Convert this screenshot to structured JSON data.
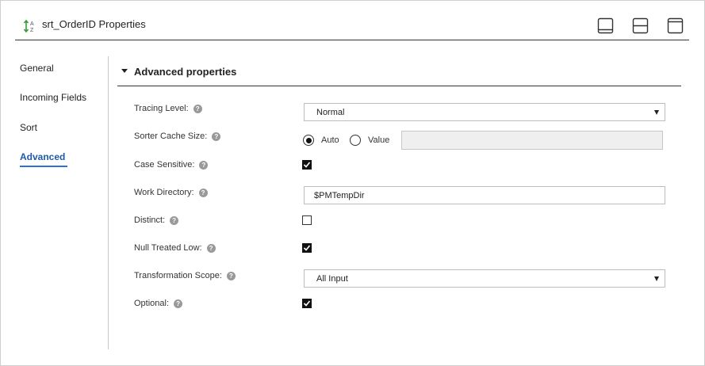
{
  "header": {
    "title": "srt_OrderID Properties",
    "icon": "sort-az-icon",
    "window_buttons": [
      "dock-bottom-icon",
      "split-horizontal-icon",
      "maximize-icon"
    ]
  },
  "nav": {
    "items": [
      {
        "label": "General",
        "active": false
      },
      {
        "label": "Incoming Fields",
        "active": false
      },
      {
        "label": "Sort",
        "active": false
      },
      {
        "label": "Advanced",
        "active": true
      }
    ]
  },
  "section": {
    "title": "Advanced properties",
    "expanded": true
  },
  "fields": {
    "tracing_level": {
      "label": "Tracing Level:",
      "value": "Normal"
    },
    "sorter_cache_size": {
      "label": "Sorter Cache Size:",
      "option_auto": "Auto",
      "option_value": "Value",
      "selected": "Auto",
      "value": ""
    },
    "case_sensitive": {
      "label": "Case Sensitive:",
      "checked": true
    },
    "work_directory": {
      "label": "Work Directory:",
      "value": "$PMTempDir"
    },
    "distinct": {
      "label": "Distinct:",
      "checked": false
    },
    "null_treated_low": {
      "label": "Null Treated Low:",
      "checked": true
    },
    "transformation_scope": {
      "label": "Transformation Scope:",
      "value": "All Input"
    },
    "optional": {
      "label": "Optional:",
      "checked": true
    }
  },
  "colors": {
    "accent": "#2a6fdb",
    "active_nav_text": "#1e5aa8",
    "help_icon": "#999999"
  }
}
